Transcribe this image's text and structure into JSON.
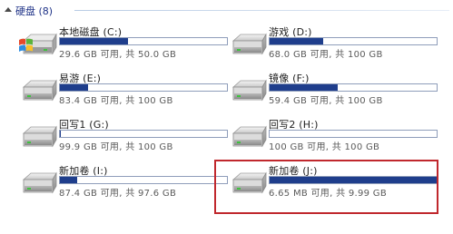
{
  "group": {
    "title": "硬盘 (8)"
  },
  "drives": [
    {
      "name": "本地磁盘 (C:)",
      "info": "29.6 GB 可用, 共 50.0 GB",
      "used_fraction": 0.41,
      "system": true
    },
    {
      "name": "游戏 (D:)",
      "info": "68.0 GB 可用, 共 100 GB",
      "used_fraction": 0.32,
      "system": false
    },
    {
      "name": "易游 (E:)",
      "info": "83.4 GB 可用, 共 100 GB",
      "used_fraction": 0.166,
      "system": false
    },
    {
      "name": "镜像 (F:)",
      "info": "59.4 GB 可用, 共 100 GB",
      "used_fraction": 0.406,
      "system": false
    },
    {
      "name": "回写1 (G:)",
      "info": "99.9 GB 可用, 共 100 GB",
      "used_fraction": 0.001,
      "system": false
    },
    {
      "name": "回写2 (H:)",
      "info": "100 GB 可用, 共 100 GB",
      "used_fraction": 0.0,
      "system": false
    },
    {
      "name": "新加卷 (I:)",
      "info": "87.4 GB 可用, 共 97.6 GB",
      "used_fraction": 0.105,
      "system": false
    },
    {
      "name": "新加卷 (J:)",
      "info": "6.65 MB 可用, 共 9.99 GB",
      "used_fraction": 0.9993,
      "system": false
    }
  ],
  "colors": {
    "bar_fill": "#1f3e8c",
    "bar_border": "#8f9dba",
    "highlight_border": "#c0282d",
    "header_text": "#1e3287"
  }
}
